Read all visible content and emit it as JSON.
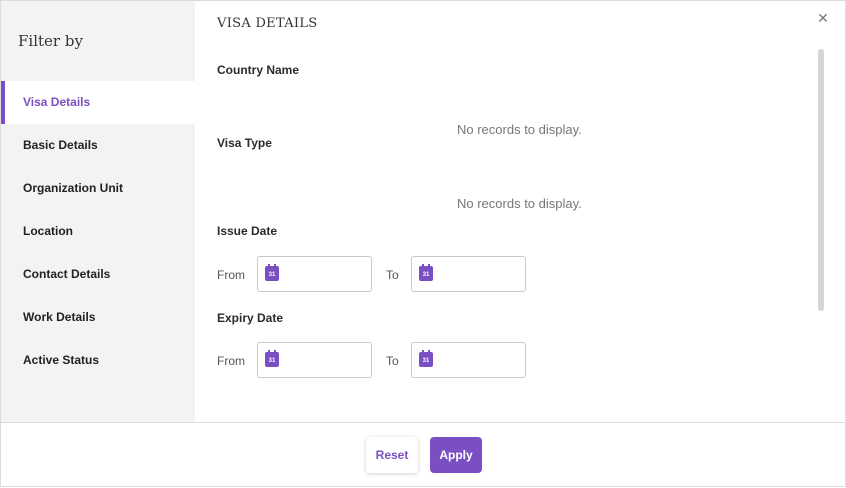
{
  "sidebar": {
    "title": "Filter by",
    "items": [
      {
        "label": "Visa Details"
      },
      {
        "label": "Basic Details"
      },
      {
        "label": "Organization Unit"
      },
      {
        "label": "Location"
      },
      {
        "label": "Contact Details"
      },
      {
        "label": "Work Details"
      },
      {
        "label": "Active Status"
      }
    ]
  },
  "section": {
    "title": "VISA DETAILS",
    "country_label": "Country Name",
    "country_empty": "No records to display.",
    "visa_type_label": "Visa Type",
    "visa_type_empty": "No records to display.",
    "issue_date_label": "Issue Date",
    "expiry_date_label": "Expiry Date",
    "from_label": "From",
    "to_label": "To",
    "calendar_day": "31"
  },
  "icons": {
    "calendar": "calendar-icon",
    "close": "close-icon"
  },
  "footer": {
    "reset_label": "Reset",
    "apply_label": "Apply"
  },
  "colors": {
    "accent": "#7b4fc4"
  }
}
